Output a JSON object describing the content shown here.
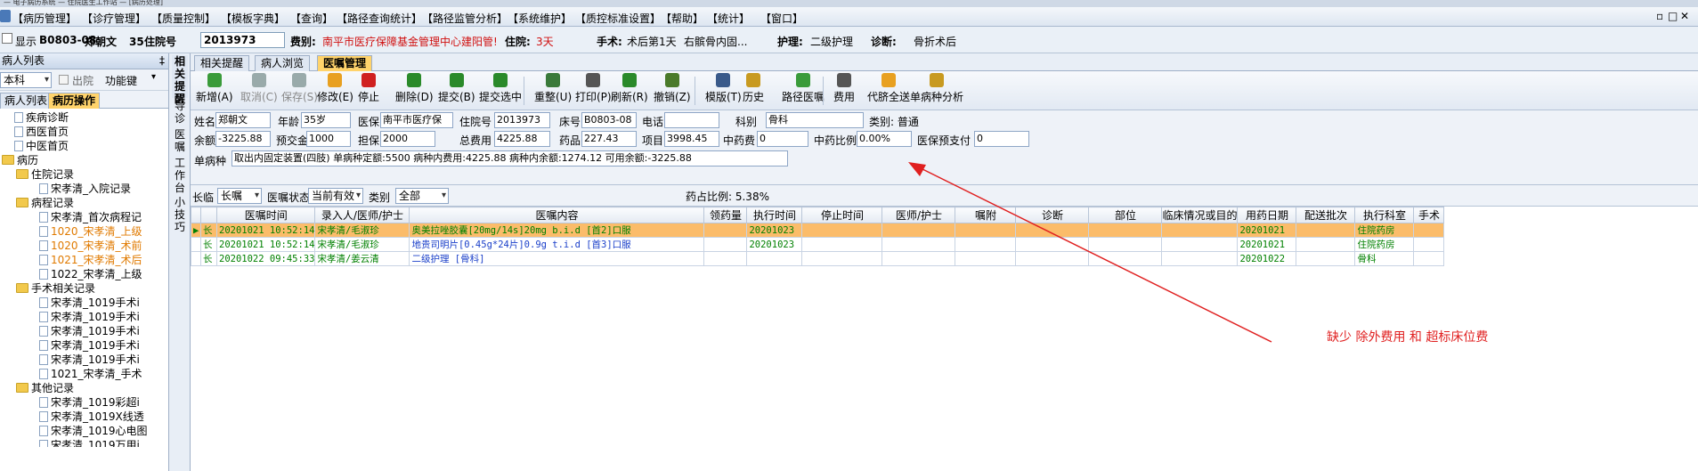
{
  "window": {
    "title_fragment": "— 电子病历系统 — 住院医生工作站 — [病历处理]"
  },
  "menu": [
    "【病历管理】",
    "【诊疗管理】",
    "【质量控制】",
    "【模板字典】",
    "【查询】",
    "【路径查询统计】",
    "【路径监管分析】",
    "【系统维护】",
    "【质控标准设置】",
    "【帮助】",
    "【统计】",
    "【窗口】"
  ],
  "window_controls": [
    "▫",
    "□",
    "✕"
  ],
  "patient_bar": {
    "show_label": "显示",
    "bed": "B0803-08",
    "name": "郑朝文",
    "age": "35岁",
    "hosp_label": "住院号",
    "hosp_no": "2013973",
    "fee_label": "费别:",
    "fee_value": "南平市医疗保障基金管理中心建阳管!",
    "inpatient_label": "住院:",
    "inpatient_days": "3天",
    "surgery_label": "手术:",
    "surgery_value": "术后第1天",
    "surgery_desc": "右髌骨内固...",
    "nursing_label": "护理:",
    "nursing_value": "二级护理",
    "diag_label": "诊断:",
    "diag_value": "骨折术后"
  },
  "left": {
    "header": "病人列表",
    "pin": "‡",
    "dept": "本科",
    "discharge_label": "出院",
    "function_label": "功能键",
    "tabs": [
      "病人列表",
      "病历操作"
    ],
    "tree": [
      {
        "label": "疾病诊断",
        "level": 1,
        "type": "doc"
      },
      {
        "label": "西医首页",
        "level": 1,
        "type": "doc"
      },
      {
        "label": "中医首页",
        "level": 1,
        "type": "doc"
      },
      {
        "label": "病历",
        "level": 0,
        "type": "folder"
      },
      {
        "label": "住院记录",
        "level": 1,
        "type": "folder"
      },
      {
        "label": "宋孝清_入院记录",
        "level": 3,
        "type": "doc"
      },
      {
        "label": "病程记录",
        "level": 1,
        "type": "folder"
      },
      {
        "label": "宋孝清_首次病程记",
        "level": 3,
        "type": "doc"
      },
      {
        "label": "1020_宋孝清_上级",
        "level": 3,
        "type": "doc",
        "style": "orange"
      },
      {
        "label": "1020_宋孝清_术前",
        "level": 3,
        "type": "doc",
        "style": "orange"
      },
      {
        "label": "1021_宋孝清_术后",
        "level": 3,
        "type": "doc",
        "style": "orange"
      },
      {
        "label": "1022_宋孝清_上级",
        "level": 3,
        "type": "doc"
      },
      {
        "label": "手术相关记录",
        "level": 1,
        "type": "folder"
      },
      {
        "label": "宋孝清_1019手术i",
        "level": 3,
        "type": "doc"
      },
      {
        "label": "宋孝清_1019手术i",
        "level": 3,
        "type": "doc"
      },
      {
        "label": "宋孝清_1019手术i",
        "level": 3,
        "type": "doc"
      },
      {
        "label": "宋孝清_1019手术i",
        "level": 3,
        "type": "doc"
      },
      {
        "label": "宋孝清_1019手术i",
        "level": 3,
        "type": "doc"
      },
      {
        "label": "1021_宋孝清_手术",
        "level": 3,
        "type": "doc"
      },
      {
        "label": "其他记录",
        "level": 1,
        "type": "folder"
      },
      {
        "label": "宋孝清_1019彩超i",
        "level": 3,
        "type": "doc"
      },
      {
        "label": "宋孝清_1019X线透",
        "level": 3,
        "type": "doc"
      },
      {
        "label": "宋孝清_1019心电图",
        "level": 3,
        "type": "doc"
      },
      {
        "label": "宋孝清_1019万用i",
        "level": 3,
        "type": "doc"
      }
    ]
  },
  "vertical_tabs": [
    "相关提醒",
    "导诊",
    "医嘱",
    "工作台",
    "小技巧"
  ],
  "main_tabs": [
    "相关提醒",
    "病人浏览",
    "医嘱管理"
  ],
  "toolbar": [
    {
      "label": "新增(A)",
      "icon": "add-icon",
      "color": "#3a9b3a"
    },
    {
      "label": "取消(C)",
      "icon": "cancel-icon",
      "color": "#9aa",
      "disabled": true
    },
    {
      "label": "保存(S)",
      "icon": "save-icon",
      "color": "#9aa",
      "disabled": true
    },
    {
      "label": "修改(E)",
      "icon": "edit-icon",
      "color": "#e8a020"
    },
    {
      "label": "停止",
      "icon": "stop-icon",
      "color": "#d02020"
    },
    {
      "label": "删除(D)",
      "icon": "delete-icon",
      "color": "#2a8a2a"
    },
    {
      "label": "提交(B)",
      "icon": "submit-icon",
      "color": "#2a8a2a"
    },
    {
      "label": "提交选中",
      "icon": "submit-selected-icon",
      "color": "#2a8a2a"
    },
    {
      "label": "重整(U)",
      "icon": "reorganize-icon",
      "color": "#3a7a3a"
    },
    {
      "label": "打印(P)",
      "icon": "print-icon",
      "color": "#555"
    },
    {
      "label": "刷新(R)",
      "icon": "refresh-icon",
      "color": "#2a8a2a"
    },
    {
      "label": "撤销(Z)",
      "icon": "undo-icon",
      "color": "#4a7a2a"
    },
    {
      "label": "模版(T)",
      "icon": "template-icon",
      "color": "#3a5a8a"
    },
    {
      "label": "历史",
      "icon": "history-icon",
      "color": "#c89a20"
    },
    {
      "label": "路径医嘱",
      "icon": "path-order-icon",
      "color": "#3a9b3a"
    },
    {
      "label": "费用",
      "icon": "fee-icon",
      "color": "#555"
    },
    {
      "label": "代脐全送",
      "icon": "send-all-icon",
      "color": "#e8a020"
    },
    {
      "label": "单病种分析",
      "icon": "analysis-icon",
      "color": "#c89a20"
    }
  ],
  "form": {
    "name_label": "姓名",
    "name": "郑朝文",
    "age_label": "年龄",
    "age": "35岁",
    "insurance_label": "医保",
    "insurance": "南平市医疗保",
    "hosp_label": "住院号",
    "hosp_no": "2013973",
    "bed_label": "床号",
    "bed": "B0803-08",
    "phone_label": "电话",
    "phone": "",
    "dept_label": "科别",
    "dept": "骨科",
    "category": "类别: 普通",
    "balance_label": "余额",
    "balance": "-3225.88",
    "prepay_label": "预交金",
    "prepay": "1000",
    "guarantee_label": "担保",
    "guarantee": "2000",
    "total_label": "总费用",
    "total": "4225.88",
    "drug_label": "药品",
    "drug": "227.43",
    "item_label": "项目",
    "item": "3998.45",
    "cm_fee_label": "中药费",
    "cm_fee": "0",
    "cm_ratio_label": "中药比例",
    "cm_ratio": "0.00%",
    "ins_prepay_label": "医保预支付",
    "ins_prepay": "0",
    "single_disease_label": "单病种",
    "single_disease": "取出内固定装置(四肢)   单病种定额:5500  病种内费用:4225.88  病种内余额:1274.12  可用余额:-3225.88"
  },
  "filter": {
    "type_label": "长临",
    "type": "长嘱",
    "status_label": "医嘱状态",
    "status": "当前有效",
    "category_label": "类别",
    "category": "全部",
    "drug_ratio": "药占比例: 5.38%"
  },
  "grid": {
    "columns": [
      "",
      "",
      "医嘱时间",
      "录入人/医师/护士",
      "医嘱内容",
      "领药量",
      "执行时间",
      "停止时间",
      "医师/护士",
      "嘱附",
      "诊断",
      "部位",
      "临床情况或目的",
      "用药日期",
      "配送批次",
      "执行科室",
      "手术"
    ],
    "rows": [
      [
        "▶",
        "长",
        "20201021 10:52:14",
        "宋孝清/毛淑珍",
        "奥美拉唑胶囊[20mg/14s]20mg  b.i.d [首2]口服",
        "",
        "20201023",
        "",
        "",
        "",
        "",
        "",
        "",
        "20201021",
        "",
        "住院药房",
        ""
      ],
      [
        "",
        "长",
        "20201021 10:52:14",
        "宋孝清/毛淑珍",
        "地贵司明片[0.45g*24片]0.9g  t.i.d [首3]口服",
        "",
        "20201023",
        "",
        "",
        "",
        "",
        "",
        "",
        "20201021",
        "",
        "住院药房",
        ""
      ],
      [
        "",
        "长",
        "20201022 09:45:33",
        "宋孝清/姜云清",
        "二级护理    [骨科]",
        "",
        "",
        "",
        "",
        "",
        "",
        "",
        "",
        "20201022",
        "",
        "骨科",
        ""
      ]
    ]
  },
  "annotation": "缺少 除外费用 和 超标床位费",
  "colors": {
    "accent": "#ffd36b",
    "selected_row": "#fbbc6a",
    "annotation": "#e02020",
    "grid_text": "#008000",
    "link_text": "#1a3fc9"
  }
}
